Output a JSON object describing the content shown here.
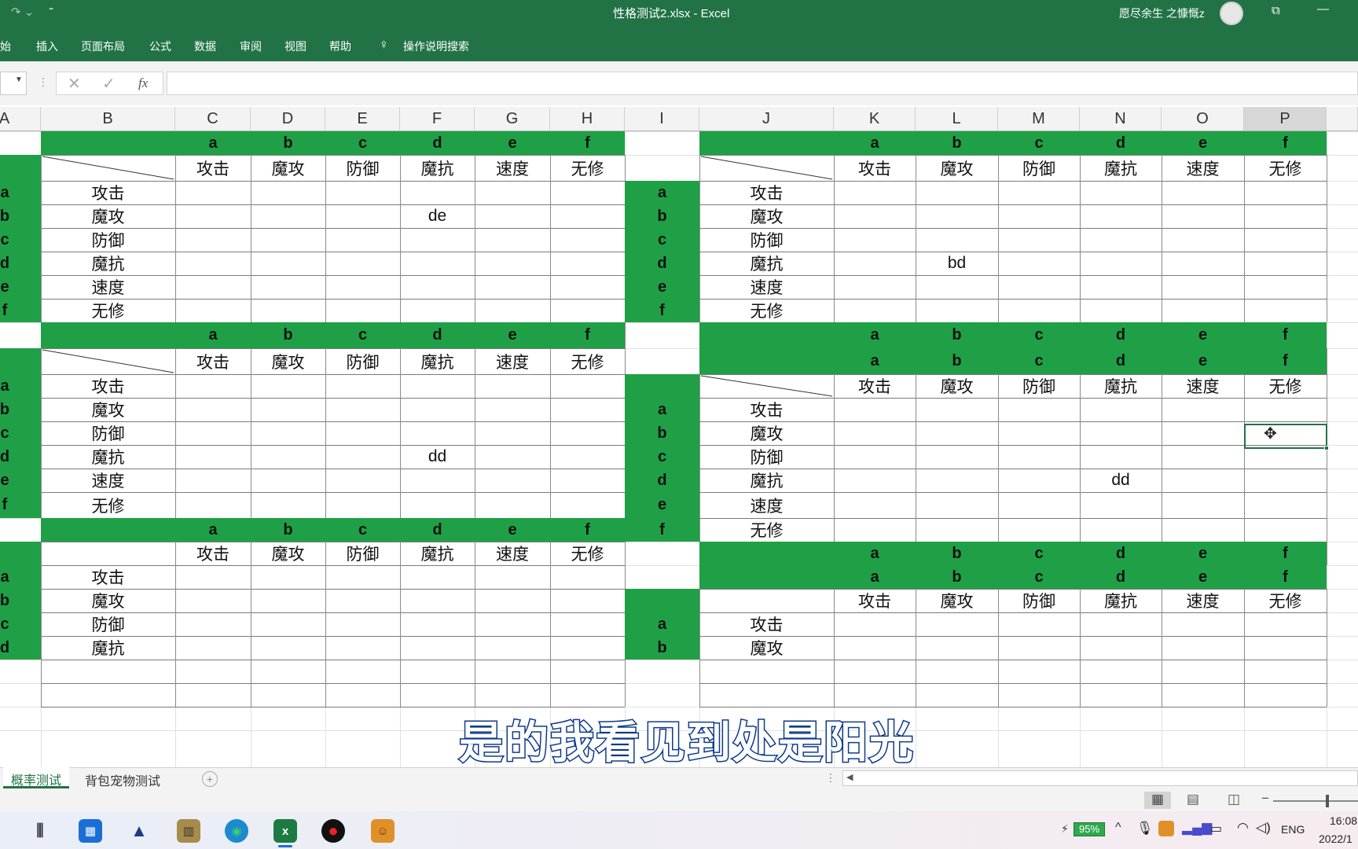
{
  "window": {
    "title": "性格测试2.xlsx  -  Excel",
    "user": "愿尽余生 之慷慨z"
  },
  "ribbon": {
    "tabs": [
      "开始",
      "插入",
      "页面布局",
      "公式",
      "数据",
      "审阅",
      "视图",
      "帮助"
    ],
    "search_label": "操作说明搜索"
  },
  "formula_bar": {
    "fx": "fx",
    "value": ""
  },
  "columns": [
    "A",
    "B",
    "C",
    "D",
    "E",
    "F",
    "G",
    "H",
    "I",
    "J",
    "K",
    "L",
    "M",
    "N",
    "O",
    "P"
  ],
  "selected_column": "P",
  "headers": {
    "letters": [
      "a",
      "b",
      "c",
      "d",
      "e",
      "f"
    ],
    "attrs": [
      "攻击",
      "魔攻",
      "防御",
      "魔抗",
      "速度",
      "无修"
    ]
  },
  "cells": {
    "t1_de": "de",
    "t2_dd": "dd",
    "r1_bd": "bd",
    "r2_dd": "dd"
  },
  "sheets": {
    "tabs": [
      "概率测试",
      "背包宠物测试"
    ],
    "active": "概率测试"
  },
  "status": {
    "battery": "95%",
    "lang": "ENG",
    "time": "16:08",
    "date": "2022/1"
  },
  "subtitle": "是的我看见到处是阳光",
  "colors": {
    "accent": "#217346",
    "cell_green": "#1fa046"
  }
}
